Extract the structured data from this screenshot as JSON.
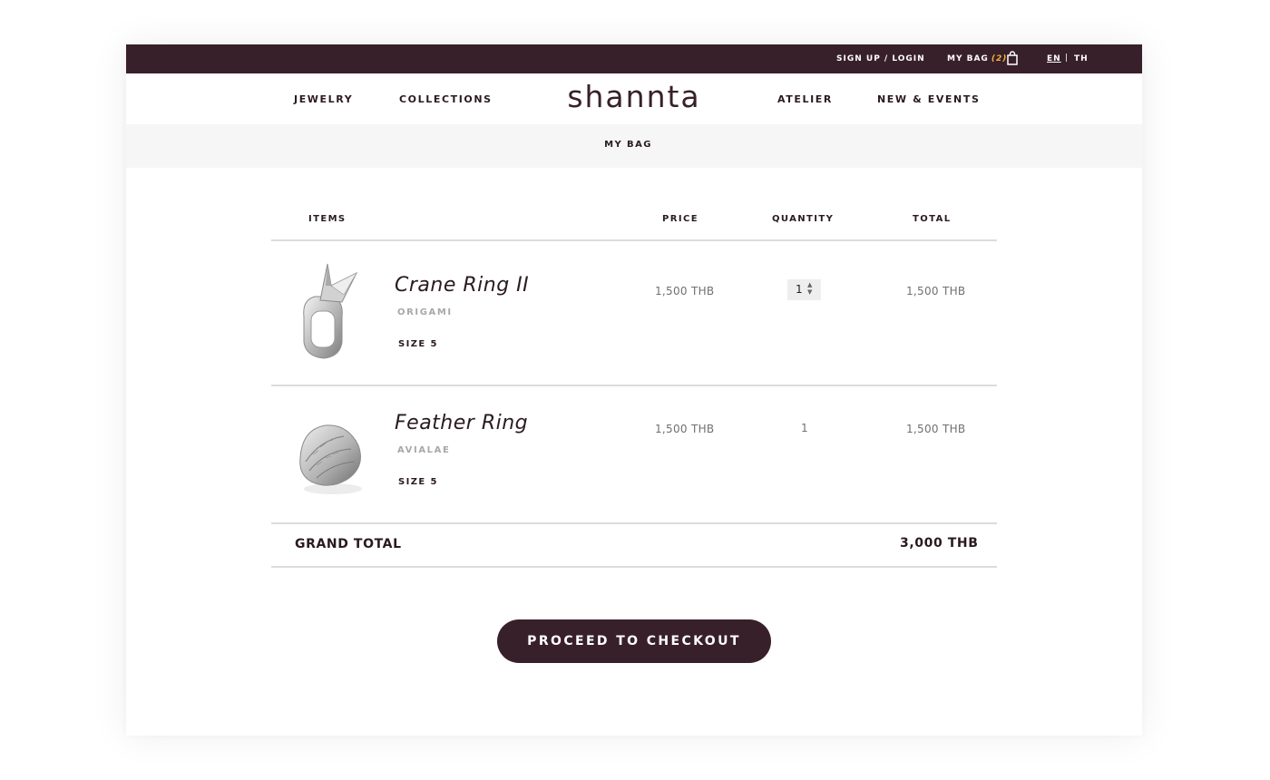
{
  "topbar": {
    "login": "SIGN UP / LOGIN",
    "bag_label": "MY BAG",
    "bag_count": "(2)",
    "lang_en": "EN",
    "lang_sep": "|",
    "lang_th": "TH"
  },
  "nav": {
    "items": [
      "JEWELRY",
      "COLLECTIONS",
      "ATELIER",
      "NEW & EVENTS"
    ],
    "logo": "shannta"
  },
  "page_title": "MY BAG",
  "table": {
    "headers": {
      "items": "ITEMS",
      "price": "PRICE",
      "quantity": "QUANTITY",
      "total": "TOTAL"
    },
    "rows": [
      {
        "name": "Crane Ring II",
        "collection": "ORIGAMI",
        "size": "SIZE 5",
        "price": "1,500 THB",
        "quantity": "1",
        "total": "1,500 THB"
      },
      {
        "name": "Feather Ring",
        "collection": "AVIALAE",
        "size": "SIZE 5",
        "price": "1,500 THB",
        "quantity": "1",
        "total": "1,500 THB"
      }
    ]
  },
  "grand_total": {
    "label": "GRAND TOTAL",
    "value": "3,000 THB"
  },
  "checkout_label": "PROCEED TO CHECKOUT",
  "colors": {
    "brand": "#38202a",
    "accent": "#f0b03c",
    "band": "#f6f6f6",
    "muted": "#a8a8a8"
  },
  "icons": {
    "bag": "shopping-bag-icon",
    "stepper": "quantity-stepper-icon"
  }
}
